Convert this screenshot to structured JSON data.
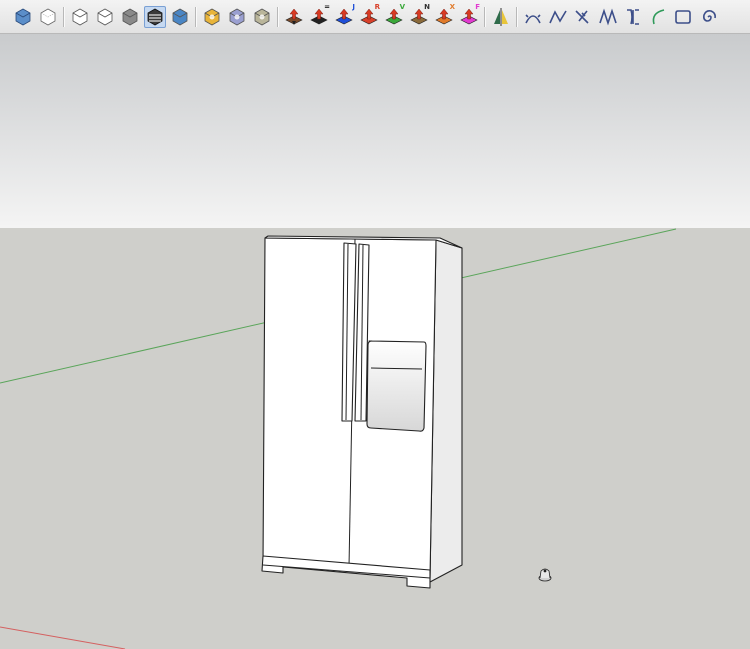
{
  "window": {
    "app": "SketchUp"
  },
  "toolbar": {
    "groups": [
      {
        "name": "views",
        "buttons": [
          {
            "id": "iso",
            "icon": "iso-view-icon",
            "fill": "#5b8ec9"
          },
          {
            "id": "xray",
            "icon": "xray-box-icon",
            "fill": "#ffffff"
          }
        ]
      },
      {
        "name": "styles",
        "buttons": [
          {
            "id": "wireframe",
            "icon": "wireframe-style-icon",
            "fill": "#ffffff"
          },
          {
            "id": "hidden-line",
            "icon": "hidden-line-style-icon",
            "fill": "#ffffff"
          },
          {
            "id": "shaded",
            "icon": "shaded-style-icon",
            "fill": "#8a8a8a"
          },
          {
            "id": "shaded-textures",
            "icon": "shaded-textures-style-icon",
            "fill": "#3a3a3a",
            "active": true
          },
          {
            "id": "monochrome",
            "icon": "monochrome-style-icon",
            "fill": "#4a86c5"
          }
        ]
      },
      {
        "name": "solid-tools",
        "buttons": [
          {
            "id": "solid-outer",
            "icon": "solid-outer-shell-icon",
            "fill": "#e8b43a"
          },
          {
            "id": "solid-intersect",
            "icon": "solid-intersect-icon",
            "fill": "#9a9fd0"
          },
          {
            "id": "solid-union",
            "icon": "solid-union-icon",
            "fill": "#b9b59a"
          }
        ]
      },
      {
        "name": "push-tools",
        "buttons": [
          {
            "id": "pushpull",
            "icon": "pushpull-arrow-icon",
            "fill": "#7a4a2a",
            "arrow": "#d83a22"
          },
          {
            "id": "push-e",
            "icon": "push-even-icon",
            "fill": "#222222",
            "arrow": "#d83a22",
            "tag": "=",
            "tagColor": "#222222"
          },
          {
            "id": "push-j",
            "icon": "push-joint-icon",
            "fill": "#1f4fd8",
            "arrow": "#d83a22",
            "tag": "J",
            "tagColor": "#1f4fd8"
          },
          {
            "id": "push-r",
            "icon": "push-round-icon",
            "fill": "#d8402a",
            "arrow": "#d83a22",
            "tag": "R",
            "tagColor": "#d8402a"
          },
          {
            "id": "push-v",
            "icon": "push-vector-icon",
            "fill": "#3aa83a",
            "arrow": "#d83a22",
            "tag": "V",
            "tagColor": "#3aa83a"
          },
          {
            "id": "push-n",
            "icon": "push-normal-icon",
            "fill": "#8a6a3a",
            "arrow": "#d83a22",
            "tag": "N",
            "tagColor": "#333333"
          },
          {
            "id": "push-x",
            "icon": "push-extrude-icon",
            "fill": "#e07a2a",
            "arrow": "#d83a22",
            "tag": "X",
            "tagColor": "#e07a2a"
          },
          {
            "id": "push-f",
            "icon": "push-follow-icon",
            "fill": "#e23ad0",
            "arrow": "#d83a22",
            "tag": "F",
            "tagColor": "#e23ad0"
          }
        ]
      },
      {
        "name": "mirror",
        "buttons": [
          {
            "id": "mirror",
            "icon": "mirror-icon",
            "fill": "#2f6b4a"
          }
        ]
      },
      {
        "name": "curve-tools",
        "buttons": [
          {
            "id": "arc-curve",
            "icon": "arc-curve-icon",
            "fill": "#3d4f8a"
          },
          {
            "id": "polyline",
            "icon": "polyline-icon",
            "fill": "#3d4f8a"
          },
          {
            "id": "freehand-pencil",
            "icon": "freehand-pencil-icon",
            "fill": "#3d4f8a"
          },
          {
            "id": "bspline",
            "icon": "bspline-icon",
            "fill": "#3d4f8a"
          },
          {
            "id": "catenary",
            "icon": "catenary-icon",
            "fill": "#3d4f8a"
          },
          {
            "id": "arc",
            "icon": "arc-icon",
            "fill": "#2f9a5a"
          },
          {
            "id": "rounded-rect",
            "icon": "rounded-rectangle-icon",
            "fill": "#3d4f8a"
          },
          {
            "id": "spiral",
            "icon": "spiral-icon",
            "fill": "#3d4f8a"
          }
        ]
      }
    ]
  },
  "scene": {
    "sky_top": "#c9cbcd",
    "sky_bottom": "#f4f4f4",
    "ground": "#cfcfcb",
    "green_axis": "#5aa55a",
    "red_axis": "#d46060",
    "model": "refrigerator",
    "fridge_fill": "#ffffff",
    "fridge_side": "#ececec",
    "edge_color": "#222222"
  }
}
